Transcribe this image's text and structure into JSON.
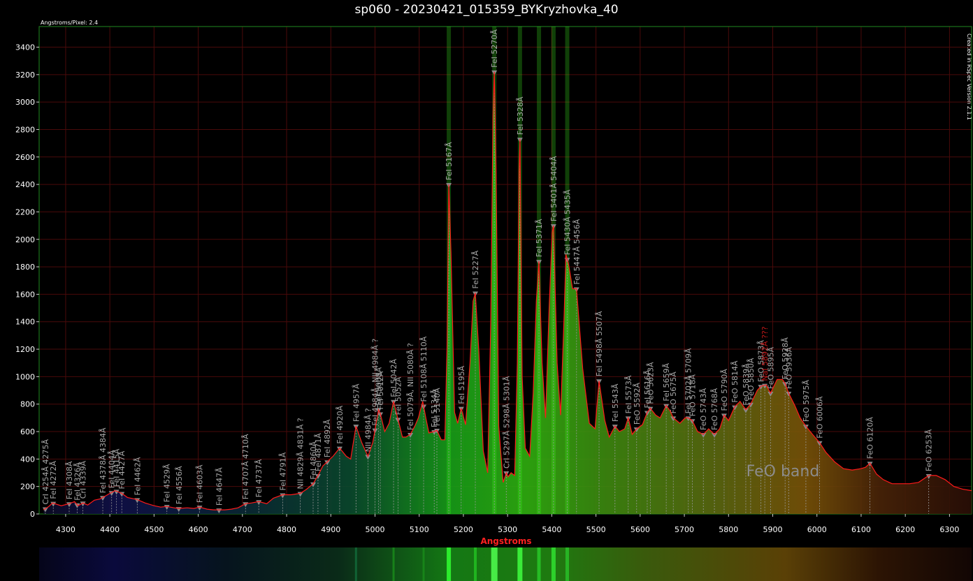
{
  "title": "sp060 - 20230421_015359_BYKryzhovka_40",
  "pixel_note": "Angstroms/Pixel: 2.4",
  "version_note": "Created in RSpec Version 2.1.1",
  "band_label": "FeO band",
  "colors": {
    "curve": "#ff1a1a",
    "frame": "#1f8a1f",
    "grid": "#4a0a0a",
    "axis_title": "#ff2020",
    "label": "#a8a8a8",
    "label_warn": "#c01818"
  },
  "chart_data": {
    "type": "line",
    "xlabel": "Angstroms",
    "ylabel": "",
    "xlim": [
      4240,
      6350
    ],
    "ylim": [
      0,
      3550
    ],
    "x_ticks": [
      4300,
      4400,
      4500,
      4600,
      4700,
      4800,
      4900,
      5000,
      5100,
      5200,
      5300,
      5400,
      5500,
      5600,
      5700,
      5800,
      5900,
      6000,
      6100,
      6200,
      6300
    ],
    "y_ticks": [
      0,
      200,
      400,
      600,
      800,
      1000,
      1200,
      1400,
      1600,
      1800,
      2000,
      2200,
      2400,
      2600,
      2800,
      3000,
      3200,
      3400
    ],
    "grid": true,
    "series": [
      {
        "x": [
          4250,
          4262,
          4270,
          4290,
          4308,
          4320,
          4328,
          4339,
          4350,
          4365,
          4378,
          4392,
          4400,
          4412,
          4427,
          4440,
          4462,
          4480,
          4500,
          4515,
          4529,
          4545,
          4556,
          4575,
          4590,
          4603,
          4620,
          4635,
          4647,
          4660,
          4675,
          4690,
          4707,
          4720,
          4737,
          4755,
          4770,
          4791,
          4810,
          4831,
          4845,
          4860,
          4871,
          4882,
          4892,
          4905,
          4920,
          4935,
          4945,
          4957,
          4970,
          4984,
          4995,
          5008,
          5012,
          5022,
          5032,
          5042,
          5052,
          5062,
          5070,
          5080,
          5090,
          5098,
          5108,
          5115,
          5122,
          5134,
          5140,
          5150,
          5158,
          5163,
          5167,
          5172,
          5180,
          5187,
          5195,
          5205,
          5215,
          5222,
          5227,
          5235,
          5245,
          5255,
          5262,
          5267,
          5270,
          5274,
          5280,
          5290,
          5297,
          5301,
          5308,
          5316,
          5322,
          5326,
          5328,
          5333,
          5340,
          5350,
          5358,
          5365,
          5371,
          5378,
          5386,
          5394,
          5401,
          5404,
          5412,
          5420,
          5428,
          5432,
          5438,
          5447,
          5456,
          5470,
          5485,
          5498,
          5507,
          5520,
          5530,
          5543,
          5553,
          5565,
          5573,
          5582,
          5592,
          5605,
          5616,
          5623,
          5635,
          5645,
          5659,
          5668,
          5675,
          5690,
          5702,
          5709,
          5718,
          5730,
          5743,
          5755,
          5768,
          5780,
          5790,
          5800,
          5814,
          5826,
          5839,
          5850,
          5865,
          5873,
          5885,
          5895,
          5910,
          5922,
          5928,
          5936,
          5950,
          5962,
          5975,
          5990,
          6006,
          6020,
          6040,
          6060,
          6080,
          6100,
          6110,
          6120,
          6135,
          6150,
          6170,
          6190,
          6210,
          6230,
          6253,
          6270,
          6290,
          6310,
          6330,
          6350
        ],
        "y": [
          30,
          55,
          80,
          60,
          75,
          90,
          60,
          80,
          65,
          100,
          110,
          135,
          150,
          170,
          150,
          120,
          105,
          80,
          60,
          50,
          55,
          45,
          40,
          45,
          40,
          50,
          35,
          30,
          30,
          30,
          35,
          45,
          75,
          80,
          90,
          75,
          115,
          140,
          140,
          150,
          180,
          220,
          280,
          350,
          380,
          420,
          480,
          420,
          400,
          640,
          520,
          420,
          520,
          760,
          730,
          600,
          660,
          820,
          690,
          560,
          560,
          580,
          640,
          700,
          820,
          700,
          590,
          600,
          610,
          540,
          540,
          1200,
          2400,
          1900,
          740,
          660,
          770,
          650,
          1100,
          1550,
          1610,
          1180,
          460,
          300,
          1400,
          2900,
          3220,
          2500,
          640,
          230,
          300,
          270,
          300,
          280,
          1100,
          2500,
          2730,
          1000,
          480,
          420,
          880,
          1550,
          1840,
          1100,
          700,
          1500,
          2050,
          2100,
          1100,
          720,
          1450,
          1890,
          1820,
          1640,
          1640,
          1060,
          660,
          620,
          970,
          680,
          560,
          640,
          600,
          620,
          700,
          580,
          620,
          650,
          740,
          770,
          720,
          700,
          790,
          750,
          700,
          660,
          700,
          700,
          680,
          600,
          580,
          620,
          580,
          620,
          720,
          680,
          780,
          820,
          760,
          800,
          900,
          930,
          940,
          880,
          980,
          980,
          950,
          880,
          790,
          700,
          640,
          580,
          520,
          450,
          380,
          330,
          320,
          330,
          340,
          370,
          290,
          250,
          220,
          220,
          220,
          230,
          280,
          280,
          250,
          200,
          180,
          170
        ]
      }
    ],
    "annotations": [
      {
        "x": 4254,
        "label": "CrI 4254Å 4275Å"
      },
      {
        "x": 4272,
        "label": "FeI 4272Å"
      },
      {
        "x": 4308,
        "label": "FeI 4308Å"
      },
      {
        "x": 4326,
        "label": "FeI 4326Å"
      },
      {
        "x": 4339,
        "label": "CrI 4339Å"
      },
      {
        "x": 4384,
        "label": "FeI 4378Å 4384Å"
      },
      {
        "x": 4404,
        "label": "FeI 4404Å"
      },
      {
        "x": 4415,
        "label": "FeI 4415Å"
      },
      {
        "x": 4427,
        "label": "FeI 4427Å"
      },
      {
        "x": 4462,
        "label": "FeI 4462Å"
      },
      {
        "x": 4529,
        "label": "FeI 4529Å"
      },
      {
        "x": 4556,
        "label": "FeI 4556Å"
      },
      {
        "x": 4603,
        "label": "FeI 4603Å"
      },
      {
        "x": 4647,
        "label": "FeI 4647Å"
      },
      {
        "x": 4707,
        "label": "FeI 4707Å 4710Å"
      },
      {
        "x": 4737,
        "label": "FeI 4737Å"
      },
      {
        "x": 4791,
        "label": "FeI 4791Å"
      },
      {
        "x": 4831,
        "label": "NII 4829Å 4831Å ?"
      },
      {
        "x": 4860,
        "label": "FeI 4860Å"
      },
      {
        "x": 4871,
        "label": "FeI 4871Å"
      },
      {
        "x": 4892,
        "label": "FeI 4892Å"
      },
      {
        "x": 4920,
        "label": "FeI 4920Å"
      },
      {
        "x": 4957,
        "label": "FeI 4957Å"
      },
      {
        "x": 4984,
        "label": "NII 4984Å ?"
      },
      {
        "x": 5000,
        "label": "FeI 4984Å, NII 4984Å ?"
      },
      {
        "x": 5008,
        "label": "FeI 5008Å"
      },
      {
        "x": 5012,
        "label": "FeI 5012Å"
      },
      {
        "x": 5042,
        "label": "FeI 5042Å"
      },
      {
        "x": 5052,
        "label": "FeI 5052Å"
      },
      {
        "x": 5080,
        "label": "FeI 5079Å, NII 5080Å ?"
      },
      {
        "x": 5110,
        "label": "FeI 5108Å 5110Å"
      },
      {
        "x": 5134,
        "label": "FeI 5134Å"
      },
      {
        "x": 5140,
        "label": "FeI 5140Å"
      },
      {
        "x": 5167,
        "label": "FeI 5167Å"
      },
      {
        "x": 5195,
        "label": "FeI 5195Å"
      },
      {
        "x": 5227,
        "label": "FeI 5227Å"
      },
      {
        "x": 5270,
        "label": "FeI 5270Å"
      },
      {
        "x": 5297,
        "label": "CrI 5297Å 5298Å 5301Å"
      },
      {
        "x": 5328,
        "label": "FeI 5328Å"
      },
      {
        "x": 5371,
        "label": "FeI 5371Å"
      },
      {
        "x": 5404,
        "label": "FeI 5401Å 5404Å"
      },
      {
        "x": 5435,
        "label": "FeI 5430Å 5435Å"
      },
      {
        "x": 5456,
        "label": "FeI 5447Å 5456Å"
      },
      {
        "x": 5507,
        "label": "FeI 5498Å 5507Å"
      },
      {
        "x": 5543,
        "label": "FeI 5543Å"
      },
      {
        "x": 5573,
        "label": "FeI 5573Å"
      },
      {
        "x": 5592,
        "label": "FeO 5592Å"
      },
      {
        "x": 5616,
        "label": "FeI 5616Å"
      },
      {
        "x": 5623,
        "label": "FeO 5623Å"
      },
      {
        "x": 5659,
        "label": "FeI 5659Å"
      },
      {
        "x": 5675,
        "label": "FeO 5675Å"
      },
      {
        "x": 5709,
        "label": "FeI 5702Å 5709Å"
      },
      {
        "x": 5718,
        "label": "FeO 5718Å"
      },
      {
        "x": 5743,
        "label": "FeO 5743Å"
      },
      {
        "x": 5768,
        "label": "FeO 5768Å"
      },
      {
        "x": 5790,
        "label": "FeO 5790Å"
      },
      {
        "x": 5814,
        "label": "FeO 5814Å"
      },
      {
        "x": 5839,
        "label": "FeO 5839Å"
      },
      {
        "x": 5850,
        "label": "FeO 5850Å"
      },
      {
        "x": 5873,
        "label": "FeO 5873Å"
      },
      {
        "x": 5882,
        "label": "NaI 5892Å ???",
        "warn": true
      },
      {
        "x": 5895,
        "label": "FeO 5895Å"
      },
      {
        "x": 5928,
        "label": "FeO 5928Å"
      },
      {
        "x": 5936,
        "label": "FeO 5936Å"
      },
      {
        "x": 5975,
        "label": "FeO 5975Å"
      },
      {
        "x": 6006,
        "label": "FeO 6006Å"
      },
      {
        "x": 6120,
        "label": "FeO 6120Å"
      },
      {
        "x": 6253,
        "label": "FeO 6253Å"
      }
    ]
  }
}
